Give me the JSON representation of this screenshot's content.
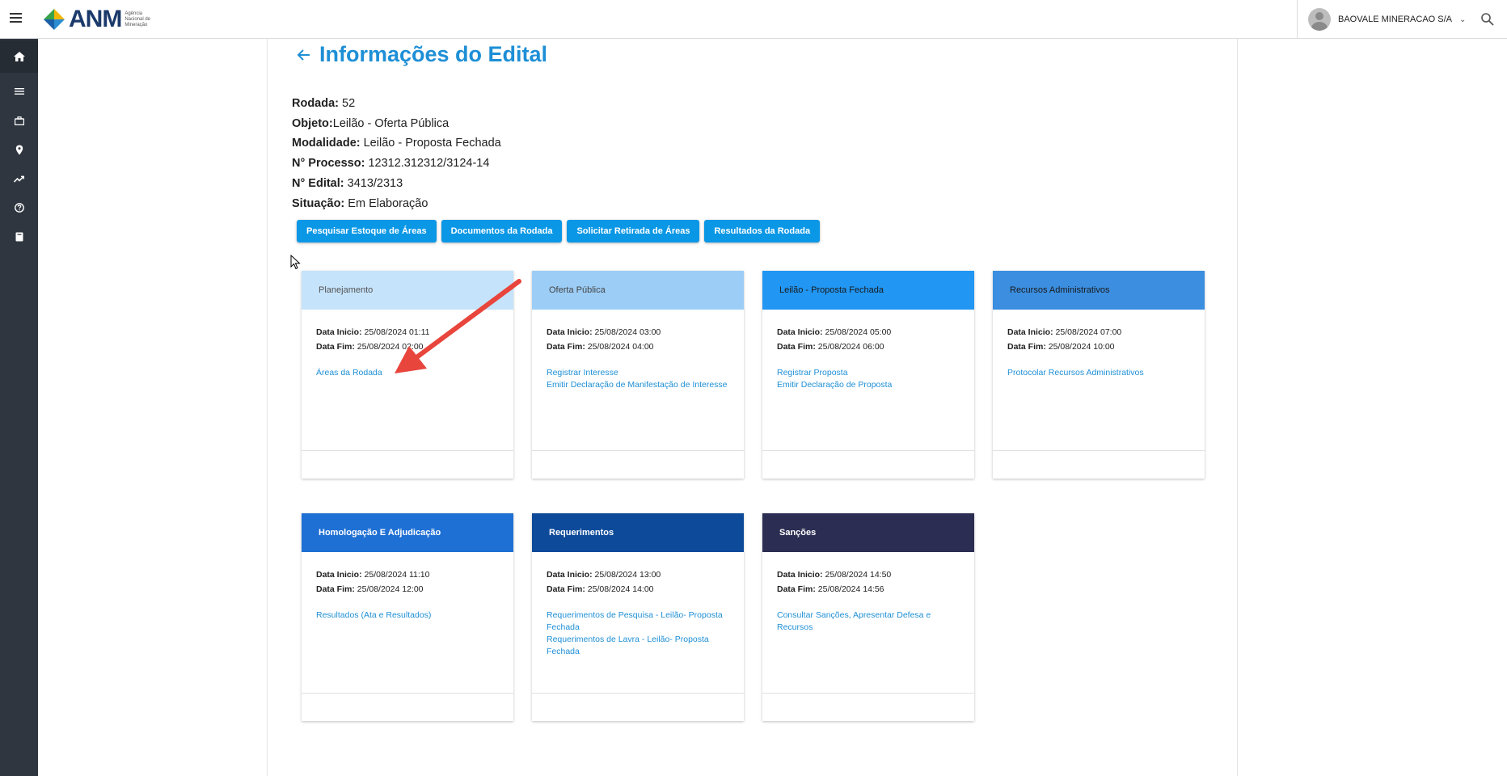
{
  "header": {
    "logo_text": "ANM",
    "logo_sub": "Agência Nacional de Mineração",
    "user_name": "BAOVALE MINERACAO S/A"
  },
  "page": {
    "title": "Informações do Edital"
  },
  "info": {
    "rodada_label": "Rodada:",
    "rodada_value": " 52",
    "objeto_label": "Objeto:",
    "objeto_value": "Leilão - Oferta Pública",
    "modalidade_label": "Modalidade:",
    "modalidade_value": " Leilão - Proposta Fechada",
    "processo_label": "N° Processo:",
    "processo_value": " 12312.312312/3124-14",
    "edital_label": "N° Edital:",
    "edital_value": " 3413/2313",
    "situacao_label": "Situação:",
    "situacao_value": " Em Elaboração"
  },
  "actions": [
    "Pesquisar Estoque de Áreas",
    "Documentos da Rodada",
    "Solicitar Retirada de Áreas",
    "Resultados da Rodada"
  ],
  "labels": {
    "inicio": "Data Inicio:",
    "fim": "Data Fim:"
  },
  "cards": [
    {
      "title": "Planejamento",
      "color": "#c5e3fb",
      "text_color": "#555555",
      "inicio": " 25/08/2024 01:11",
      "fim": " 25/08/2024 02:00",
      "links": [
        "Áreas da Rodada"
      ]
    },
    {
      "title": "Oferta Pública",
      "color": "#9ccdf6",
      "text_color": "#444444",
      "inicio": " 25/08/2024 03:00",
      "fim": " 25/08/2024 04:00",
      "links": [
        "Registrar Interesse",
        "Emitir Declaração de Manifestação de Interesse"
      ]
    },
    {
      "title": "Leilão - Proposta Fechada",
      "color": "#2196f3",
      "text_color": "#1a1a1a",
      "inicio": " 25/08/2024 05:00",
      "fim": " 25/08/2024 06:00",
      "links": [
        "Registrar Proposta",
        "Emitir Declaração de Proposta"
      ]
    },
    {
      "title": "Recursos Administrativos",
      "color": "#3b8ee0",
      "text_color": "#1a1a1a",
      "inicio": " 25/08/2024 07:00",
      "fim": " 25/08/2024 10:00",
      "links": [
        "Protocolar Recursos Administrativos"
      ]
    },
    {
      "title": "Homologação E Adjudicação",
      "color": "#1f70d4",
      "text_color": "#ffffff",
      "inicio": " 25/08/2024 11:10",
      "fim": " 25/08/2024 12:00",
      "links": [
        "Resultados (Ata e Resultados)"
      ]
    },
    {
      "title": "Requerimentos",
      "color": "#0d4a9a",
      "text_color": "#ffffff",
      "inicio": " 25/08/2024 13:00",
      "fim": " 25/08/2024 14:00",
      "links": [
        "Requerimentos de Pesquisa - Leilão- Proposta Fechada",
        "Requerimentos de Lavra - Leilão- Proposta Fechada"
      ]
    },
    {
      "title": "Sanções",
      "color": "#2c2d52",
      "text_color": "#ffffff",
      "inicio": " 25/08/2024 14:50",
      "fim": " 25/08/2024 14:56",
      "links": [
        "Consultar Sanções, Apresentar Defesa e Recursos"
      ]
    }
  ],
  "sidebar_icons": [
    "home-icon",
    "list-icon",
    "briefcase-icon",
    "map-pin-icon",
    "trending-up-icon",
    "help-icon",
    "book-icon"
  ],
  "colors": {
    "accent": "#1e8fd6",
    "button": "#0a97e6",
    "sidebar": "#2f3640",
    "annotation_arrow": "#e8453c"
  }
}
